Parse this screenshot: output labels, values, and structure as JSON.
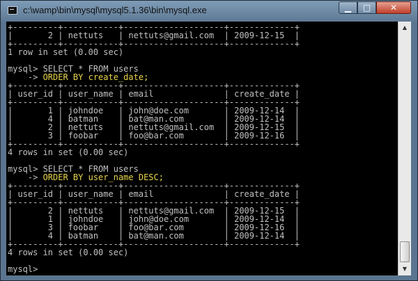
{
  "window": {
    "title": "c:\\wamp\\bin\\mysql\\mysql5.1.36\\bin\\mysql.exe",
    "buttons": {
      "minimize": "▁",
      "maximize": "□",
      "close": "✕"
    }
  },
  "console": {
    "lines": [
      {
        "parts": [
          {
            "text": "+---------+-----------+--------------------+-------------+"
          }
        ]
      },
      {
        "parts": [
          {
            "text": "|       2 | nettuts   | nettuts@gmail.com  | 2009-12-15  |"
          }
        ]
      },
      {
        "parts": [
          {
            "text": "+---------+-----------+--------------------+-------------+"
          }
        ]
      },
      {
        "parts": [
          {
            "text": "1 row in set (0.00 sec)"
          }
        ]
      },
      {
        "parts": [
          {
            "text": ""
          }
        ]
      },
      {
        "parts": [
          {
            "text": "mysql> SELECT * FROM users"
          }
        ]
      },
      {
        "parts": [
          {
            "text": "    -> "
          },
          {
            "text": "ORDER BY create_date;",
            "hl": true
          }
        ]
      },
      {
        "parts": [
          {
            "text": "+---------+-----------+--------------------+-------------+"
          }
        ]
      },
      {
        "parts": [
          {
            "text": "| user_id | user_name | email              | create_date |"
          }
        ]
      },
      {
        "parts": [
          {
            "text": "+---------+-----------+--------------------+-------------+"
          }
        ]
      },
      {
        "parts": [
          {
            "text": "|       1 | johndoe   | john@doe.com       | 2009-12-14  |"
          }
        ]
      },
      {
        "parts": [
          {
            "text": "|       4 | batman    | bat@man.com        | 2009-12-14  |"
          }
        ]
      },
      {
        "parts": [
          {
            "text": "|       2 | nettuts   | nettuts@gmail.com  | 2009-12-15  |"
          }
        ]
      },
      {
        "parts": [
          {
            "text": "|       3 | foobar    | foo@bar.com        | 2009-12-16  |"
          }
        ]
      },
      {
        "parts": [
          {
            "text": "+---------+-----------+--------------------+-------------+"
          }
        ]
      },
      {
        "parts": [
          {
            "text": "4 rows in set (0.00 sec)"
          }
        ]
      },
      {
        "parts": [
          {
            "text": ""
          }
        ]
      },
      {
        "parts": [
          {
            "text": "mysql> SELECT * FROM users"
          }
        ]
      },
      {
        "parts": [
          {
            "text": "    -> "
          },
          {
            "text": "ORDER BY user_name DESC;",
            "hl": true
          }
        ]
      },
      {
        "parts": [
          {
            "text": "+---------+-----------+--------------------+-------------+"
          }
        ]
      },
      {
        "parts": [
          {
            "text": "| user_id | user_name | email              | create_date |"
          }
        ]
      },
      {
        "parts": [
          {
            "text": "+---------+-----------+--------------------+-------------+"
          }
        ]
      },
      {
        "parts": [
          {
            "text": "|       2 | nettuts   | nettuts@gmail.com  | 2009-12-15  |"
          }
        ]
      },
      {
        "parts": [
          {
            "text": "|       1 | johndoe   | john@doe.com       | 2009-12-14  |"
          }
        ]
      },
      {
        "parts": [
          {
            "text": "|       3 | foobar    | foo@bar.com        | 2009-12-16  |"
          }
        ]
      },
      {
        "parts": [
          {
            "text": "|       4 | batman    | bat@man.com        | 2009-12-14  |"
          }
        ]
      },
      {
        "parts": [
          {
            "text": "+---------+-----------+--------------------+-------------+"
          }
        ]
      },
      {
        "parts": [
          {
            "text": "4 rows in set (0.00 sec)"
          }
        ]
      },
      {
        "parts": [
          {
            "text": ""
          }
        ]
      },
      {
        "parts": [
          {
            "text": "mysql> "
          }
        ]
      }
    ]
  },
  "scrollbar": {
    "up_arrow": "▲",
    "down_arrow": "▼"
  },
  "colors": {
    "text": "#c0c0c0",
    "highlight": "#e6d44a",
    "background": "#000000"
  }
}
